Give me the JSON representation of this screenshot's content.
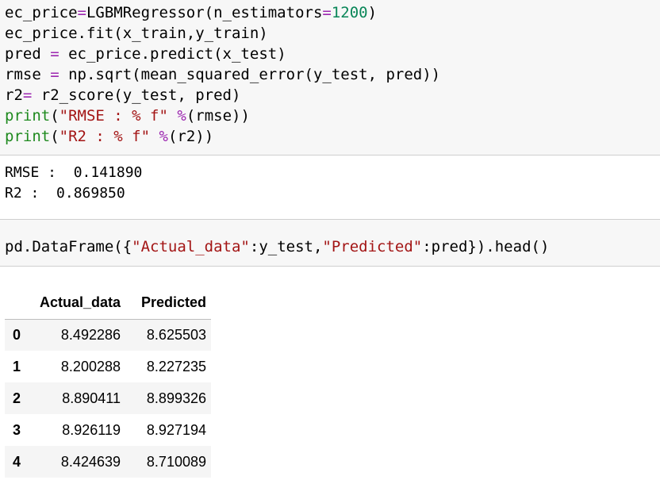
{
  "cell1": {
    "lines": [
      [
        {
          "t": "ec_price",
          "c": ""
        },
        {
          "t": "=",
          "c": "op"
        },
        {
          "t": "LGBMRegressor(n_estimators",
          "c": ""
        },
        {
          "t": "=",
          "c": "op"
        },
        {
          "t": "1200",
          "c": "num"
        },
        {
          "t": ")",
          "c": ""
        }
      ],
      [
        {
          "t": "ec_price.fit(x_train,y_train)",
          "c": ""
        }
      ],
      [
        {
          "t": "pred ",
          "c": ""
        },
        {
          "t": "=",
          "c": "op"
        },
        {
          "t": " ec_price.predict(x_test)",
          "c": ""
        }
      ],
      [
        {
          "t": "rmse ",
          "c": ""
        },
        {
          "t": "=",
          "c": "op"
        },
        {
          "t": " np.sqrt(mean_squared_error(y_test, pred))",
          "c": ""
        }
      ],
      [
        {
          "t": "r2",
          "c": ""
        },
        {
          "t": "=",
          "c": "op"
        },
        {
          "t": " r2_score(y_test, pred)",
          "c": ""
        }
      ],
      [
        {
          "t": "print",
          "c": "fn"
        },
        {
          "t": "(",
          "c": ""
        },
        {
          "t": "\"RMSE : % f\"",
          "c": "str"
        },
        {
          "t": " ",
          "c": ""
        },
        {
          "t": "%",
          "c": "op"
        },
        {
          "t": "(rmse))",
          "c": ""
        }
      ],
      [
        {
          "t": "print",
          "c": "fn"
        },
        {
          "t": "(",
          "c": ""
        },
        {
          "t": "\"R2 : % f\"",
          "c": "str"
        },
        {
          "t": " ",
          "c": ""
        },
        {
          "t": "%",
          "c": "op"
        },
        {
          "t": "(r2))",
          "c": ""
        }
      ]
    ]
  },
  "output": {
    "rmse_line": "RMSE :  0.141890",
    "r2_line": "R2 :  0.869850"
  },
  "cell2": {
    "lines": [
      [
        {
          "t": "pd.DataFrame({",
          "c": ""
        },
        {
          "t": "\"Actual_data\"",
          "c": "str"
        },
        {
          "t": ":y_test,",
          "c": ""
        },
        {
          "t": "\"Predicted\"",
          "c": "str"
        },
        {
          "t": ":pred}).head()",
          "c": ""
        }
      ]
    ]
  },
  "dataframe": {
    "columns": [
      "",
      "Actual_data",
      "Predicted"
    ],
    "rows": [
      {
        "index": "0",
        "actual": "8.492286",
        "predicted": "8.625503"
      },
      {
        "index": "1",
        "actual": "8.200288",
        "predicted": "8.227235"
      },
      {
        "index": "2",
        "actual": "8.890411",
        "predicted": "8.899326"
      },
      {
        "index": "3",
        "actual": "8.926119",
        "predicted": "8.927194"
      },
      {
        "index": "4",
        "actual": "8.424639",
        "predicted": "8.710089"
      }
    ]
  },
  "colors": {
    "cell_background": "#f7f7f7",
    "number": "#098658",
    "operator": "#9c27b0",
    "function": "#1f8a1f",
    "string": "#a31515"
  }
}
